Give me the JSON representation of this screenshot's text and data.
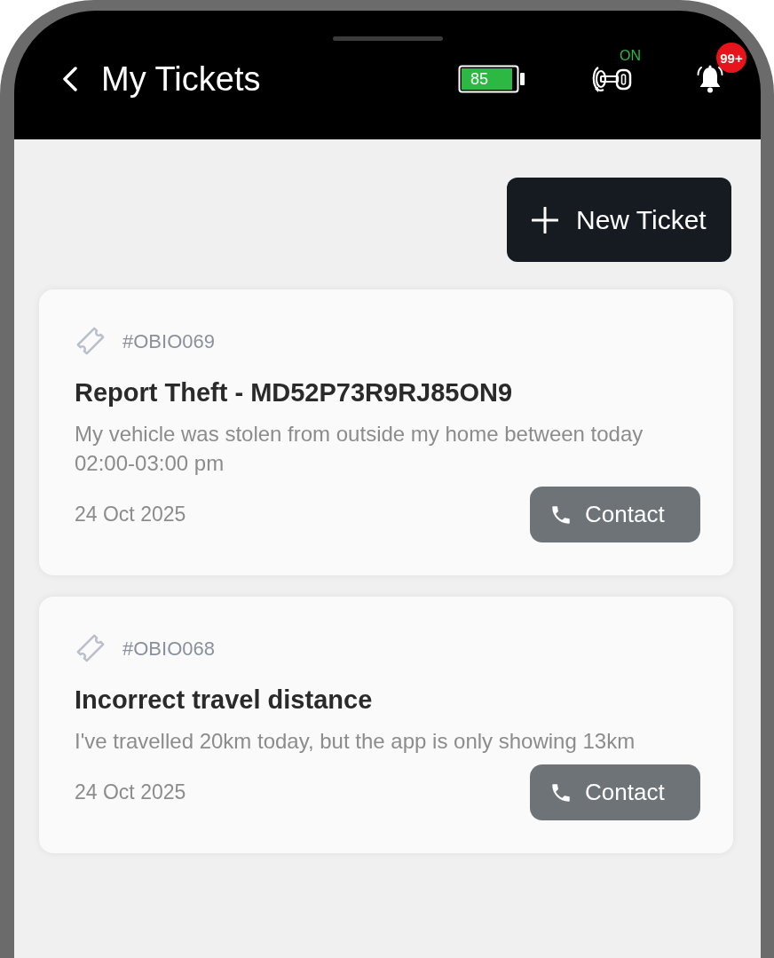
{
  "header": {
    "title": "My Tickets",
    "battery": {
      "reading": "85"
    },
    "ignition": {
      "status": "ON"
    },
    "notifications": {
      "badge": "99+"
    }
  },
  "new_ticket_button": {
    "label": "New Ticket"
  },
  "tickets": [
    {
      "id": "#OBIO069",
      "title": "Report Theft - MD52P73R9RJ85ON9",
      "description": "My vehicle was stolen from outside my home between today 02:00-03:00 pm",
      "date": "24 Oct 2025",
      "contact_button": "Contact"
    },
    {
      "id": "#OBIO068",
      "title": "Incorrect travel distance",
      "description": "I've travelled 20km today, but the app is only showing 13km",
      "date": "24 Oct 2025",
      "contact_button": "Contact"
    }
  ]
}
